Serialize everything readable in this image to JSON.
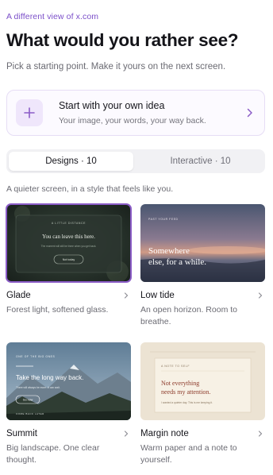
{
  "header": {
    "eyebrow": "A different view of x.com",
    "title": "What would you rather see?",
    "subtitle": "Pick a starting point. Make it yours on the next screen."
  },
  "own_idea": {
    "title": "Start with your own idea",
    "subtitle": "Your image, your words, your way back.",
    "icon": "plus-icon"
  },
  "tabs": [
    {
      "label": "Designs · 10",
      "active": true
    },
    {
      "label": "Interactive · 10",
      "active": false
    }
  ],
  "hint": "A quieter screen, in a style that feels like you.",
  "designs": [
    {
      "name": "Glade",
      "description": "Forest light, softened glass.",
      "selected": true,
      "preview": {
        "kicker": "A LITTLE DISTANCE",
        "headline": "You can leave this here.",
        "body": "The moment will still be there when you get back.",
        "button": "Not today"
      }
    },
    {
      "name": "Low tide",
      "description": "An open horizon. Room to breathe.",
      "selected": false,
      "preview": {
        "kicker": "PAST YOUR FEED",
        "headline_1": "Somewhere",
        "headline_2": "else, for a while."
      }
    },
    {
      "name": "Summit",
      "description": "Big landscape. One clear thought.",
      "selected": false,
      "preview": {
        "kicker": "ONE OF THE BIG ONES",
        "headline": "Take the long way back.",
        "body": "There will always be more. It can wait.",
        "button": "Go now",
        "footer": "COME BACK LATER"
      }
    },
    {
      "name": "Margin note",
      "description": "Warm paper and a note to yourself.",
      "selected": false,
      "preview": {
        "kicker": "A NOTE TO SELF",
        "headline_1": "Not everything",
        "headline_2": "needs my attention.",
        "body": "I wanted a quieter day. This is me keeping it."
      }
    }
  ]
}
